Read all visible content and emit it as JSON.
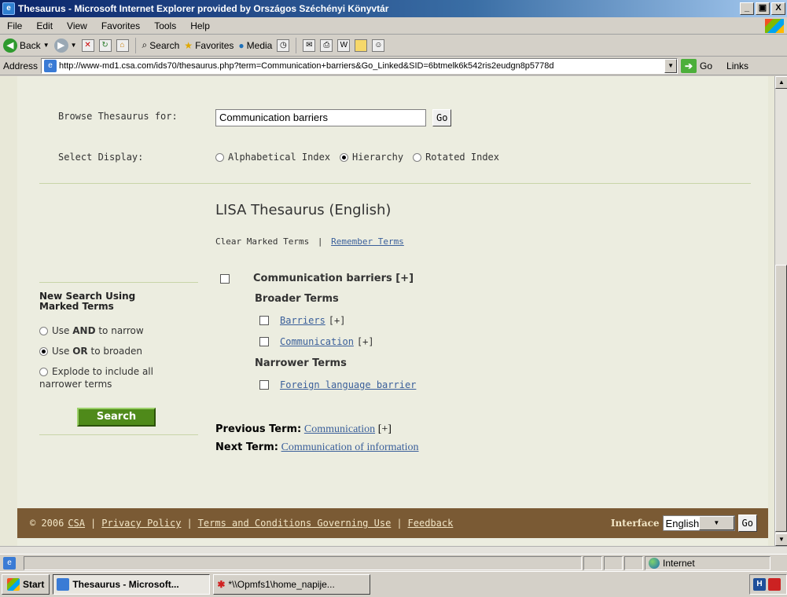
{
  "window": {
    "title": "Thesaurus - Microsoft Internet Explorer provided by Országos Széchényi Könyvtár",
    "controls": [
      "_",
      "Ơ",
      "X"
    ]
  },
  "menubar": {
    "items": [
      "File",
      "Edit",
      "View",
      "Favorites",
      "Tools",
      "Help"
    ]
  },
  "toolbar": {
    "back": "Back",
    "search": "Search",
    "favorites": "Favorites",
    "media": "Media"
  },
  "addressbar": {
    "label": "Address",
    "url": "http://www-md1.csa.com/ids70/thesaurus.php?term=Communication+barriers&Go_Linked&SID=6btmelk6k542ris2eudgn8p5778d",
    "go_label": "Go",
    "links_label": "Links"
  },
  "page": {
    "browse_label": "Browse Thesaurus for:",
    "browse_value": "Communication barriers",
    "browse_go": "Go",
    "display_label": "Select Display:",
    "display_options": [
      {
        "label": "Alphabetical Index",
        "selected": false
      },
      {
        "label": "Hierarchy",
        "selected": true
      },
      {
        "label": "Rotated Index",
        "selected": false
      }
    ],
    "thesaurus_title": "LISA Thesaurus (English)",
    "clear_marked": "Clear Marked Terms",
    "action_separator": "|",
    "remember_terms": "Remember Terms",
    "main_term": "Communication barriers [+]",
    "broader_heading": "Broader Terms",
    "broader_terms": [
      {
        "label": "Barriers",
        "suffix": "[+]"
      },
      {
        "label": "Communication",
        "suffix": "[+]"
      }
    ],
    "narrower_heading": "Narrower Terms",
    "narrower_terms": [
      {
        "label": "Foreign language barrier",
        "suffix": ""
      }
    ],
    "previous_label": "Previous Term:",
    "previous_term": "Communication",
    "previous_suffix": "[+]",
    "next_label": "Next Term:",
    "next_term": "Communication of information"
  },
  "sidebar": {
    "heading_line1": "New Search Using",
    "heading_line2": "Marked Terms",
    "options": [
      {
        "prefix": "Use ",
        "bold": "AND",
        "suffix": " to narrow",
        "selected": false
      },
      {
        "prefix": "Use ",
        "bold": "OR",
        "suffix": " to broaden",
        "selected": true
      },
      {
        "prefix": "Explode to include all narrower terms",
        "bold": "",
        "suffix": "",
        "selected": false
      }
    ],
    "search_button": "Search"
  },
  "footer": {
    "copyright": "© 2006",
    "csa_link": "CSA",
    "privacy": "Privacy Policy",
    "terms": "Terms and Conditions Governing Use",
    "feedback": "Feedback",
    "separator": "|",
    "interface_label": "Interface",
    "language": "English",
    "go": "Go"
  },
  "status": {
    "zone": "Internet"
  },
  "taskbar": {
    "start": "Start",
    "tasks": [
      {
        "label": "Thesaurus - Microsoft...",
        "active": true
      },
      {
        "label": "*\\\\Opmfs1\\home_napije...",
        "active": false
      }
    ]
  },
  "colors": {
    "page_bg": "#ecede0",
    "footer_bg": "#7a5a34",
    "link": "#3a5f9a",
    "search_button": "#4f8a1a",
    "title_bar": "#0a246a"
  }
}
